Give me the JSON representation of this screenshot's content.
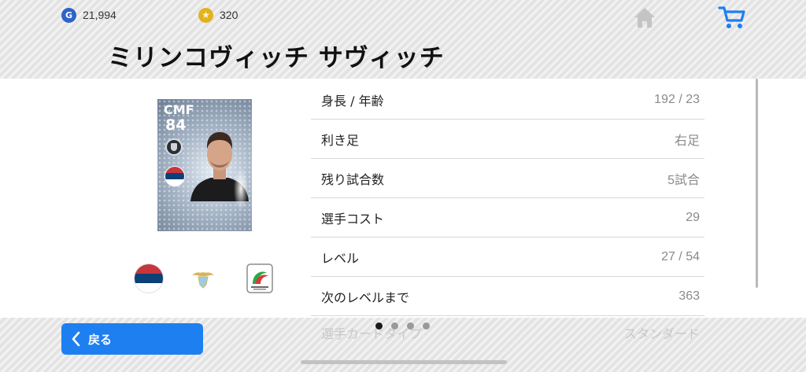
{
  "currency": {
    "gp_icon_letter": "G",
    "gp_amount": "21,994",
    "coin_icon": "star-coin-icon",
    "coin_amount": "320"
  },
  "nav": {
    "home_icon": "home-icon",
    "cart_icon": "cart-icon",
    "accent_color": "#1e7ff0"
  },
  "player": {
    "name": "ミリンコヴィッチ サヴィッチ"
  },
  "card": {
    "position": "CMF",
    "rating": "84"
  },
  "stats": [
    {
      "label": "身長 / 年齢",
      "value": "192 / 23"
    },
    {
      "label": "利き足",
      "value": "右足"
    },
    {
      "label": "残り試合数",
      "value": "5試合"
    },
    {
      "label": "選手コスト",
      "value": "29"
    },
    {
      "label": "レベル",
      "value": "27 / 54"
    },
    {
      "label": "次のレベルまで",
      "value": "363"
    },
    {
      "label": "選手カードタイプ",
      "value": "スタンダード"
    }
  ],
  "footer": {
    "back_label": "戻る",
    "page_count": 4,
    "active_page": 1
  }
}
